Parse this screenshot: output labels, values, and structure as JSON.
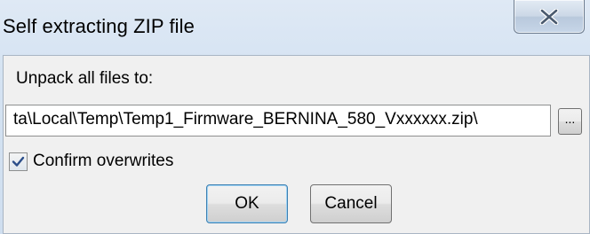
{
  "window": {
    "title": "Self extracting ZIP file",
    "close_icon": "close-icon"
  },
  "form": {
    "unpack_label": "Unpack all files to:",
    "path_value": "ta\\Local\\Temp\\Temp1_Firmware_BERNINA_580_Vxxxxxx.zip\\",
    "browse_label": "...",
    "confirm_label": "Confirm overwrites",
    "confirm_checked": true
  },
  "buttons": {
    "ok_label": "OK",
    "cancel_label": "Cancel"
  }
}
